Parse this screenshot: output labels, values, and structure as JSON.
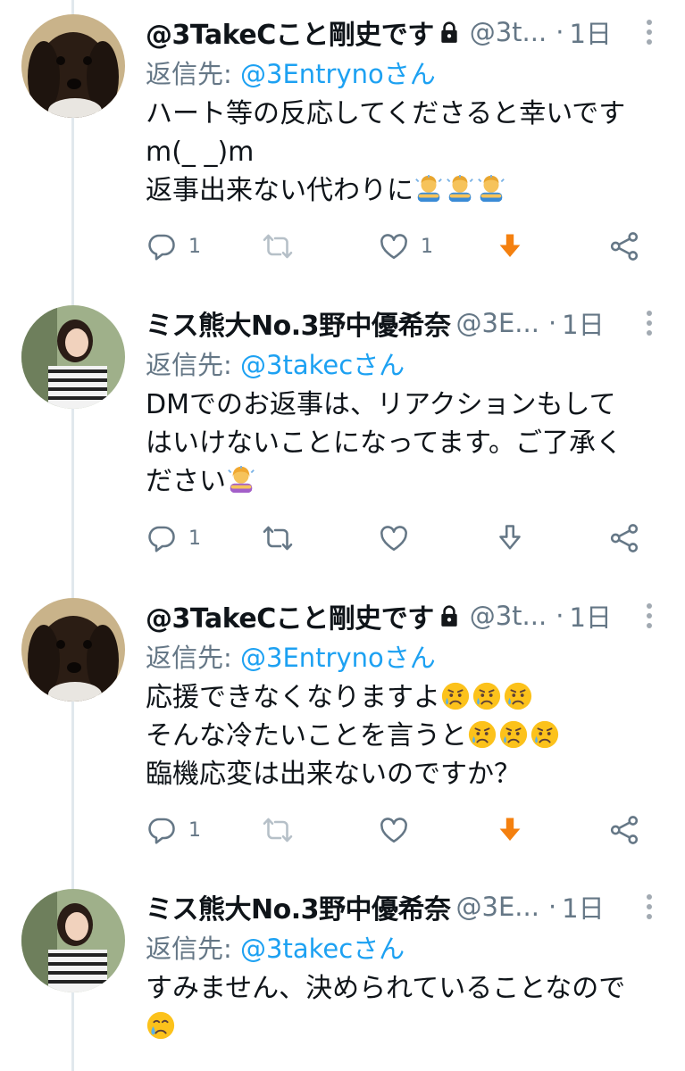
{
  "tweets": [
    {
      "name": "@3TakeCこと剛史です",
      "locked": true,
      "handle": "@3t...",
      "time": "1日",
      "reply_prefix": "返信先: ",
      "reply_to": "@3Entrynoさん",
      "lines": [
        "ハート等の反応してくださると幸いです",
        "m(_ _)m",
        "返事出来ない代わりに"
      ],
      "line_emoji": [
        "",
        "",
        "person-bowing ×3"
      ],
      "replies": "1",
      "likes": "1",
      "download_active": true
    },
    {
      "name": "ミス熊大No.3野中優希奈",
      "locked": false,
      "handle": "@3E...",
      "time": "1日",
      "reply_prefix": "返信先: ",
      "reply_to": "@3takecさん",
      "lines": [
        "DMでのお返事は、リアクションもして",
        "はいけないことになってます。ご了承く",
        "ださい"
      ],
      "line_emoji": [
        "",
        "",
        "woman-bowing"
      ],
      "replies": "1",
      "likes": "",
      "download_active": false
    },
    {
      "name": "@3TakeCこと剛史です",
      "locked": true,
      "handle": "@3t...",
      "time": "1日",
      "reply_prefix": "返信先: ",
      "reply_to": "@3Entrynoさん",
      "lines": [
        "応援できなくなりますよ",
        "そんな冷たいことを言うと",
        "臨機応変は出来ないのですか？"
      ],
      "line_emoji": [
        "sad-relieved ×3",
        "sad-relieved ×3",
        ""
      ],
      "replies": "1",
      "likes": "",
      "download_active": true
    },
    {
      "name": "ミス熊大No.3野中優希奈",
      "locked": false,
      "handle": "@3E...",
      "time": "1日",
      "reply_prefix": "返信先: ",
      "reply_to": "@3takecさん",
      "lines": [
        "すみません、決められていることなので",
        ""
      ],
      "line_emoji": [
        "",
        "crying-face"
      ],
      "replies": "",
      "likes": "",
      "download_active": false
    }
  ],
  "colors": {
    "accent": "#1da1f2",
    "muted": "#657786",
    "download_active": "#f4800f",
    "thread_line": "#e1e8ed"
  },
  "icons": [
    "reply-icon",
    "retweet-icon",
    "like-icon",
    "download-icon",
    "share-icon",
    "lock-icon",
    "more-icon"
  ]
}
